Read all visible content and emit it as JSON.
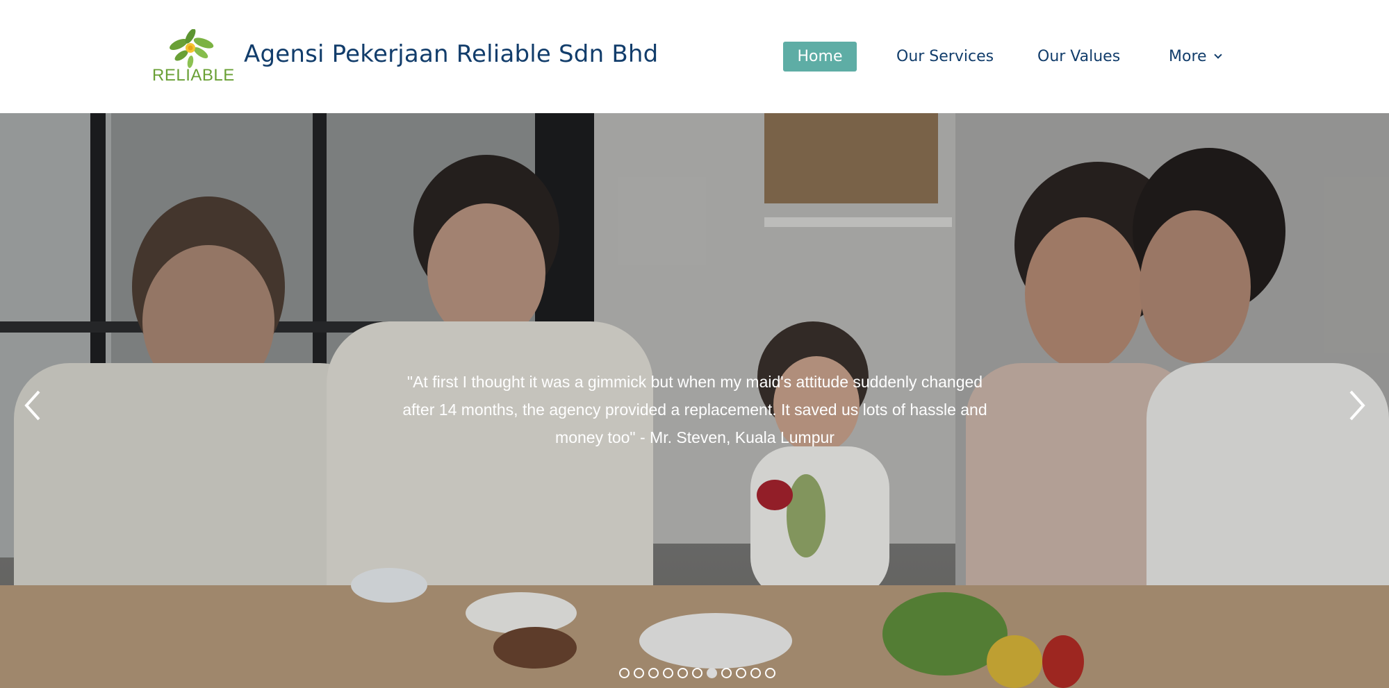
{
  "header": {
    "logo_text": "RELIABLE",
    "site_title": "Agensi Pekerjaan Reliable Sdn Bhd"
  },
  "nav": {
    "items": [
      {
        "label": "Home",
        "active": true
      },
      {
        "label": "Our Services",
        "active": false
      },
      {
        "label": "Our Values",
        "active": false
      },
      {
        "label": "More",
        "active": false,
        "has_dropdown": true
      }
    ]
  },
  "slideshow": {
    "quote": "\"At first I thought it was a gimmick but when my maid's attitude suddenly changed after 14 months, the agency provided a replacement. It saved us lots of hassle and money too\" - Mr. Steven, Kuala Lumpur",
    "slide_count": 11,
    "active_slide": 7
  },
  "colors": {
    "nav_active_bg": "#5eada5",
    "title_color": "#123d6b",
    "logo_green": "#6aa036"
  },
  "icons": {
    "prev": "chevron-left-icon",
    "next": "chevron-right-icon",
    "dropdown": "chevron-down-icon",
    "logo": "leaf-flower-logo"
  }
}
